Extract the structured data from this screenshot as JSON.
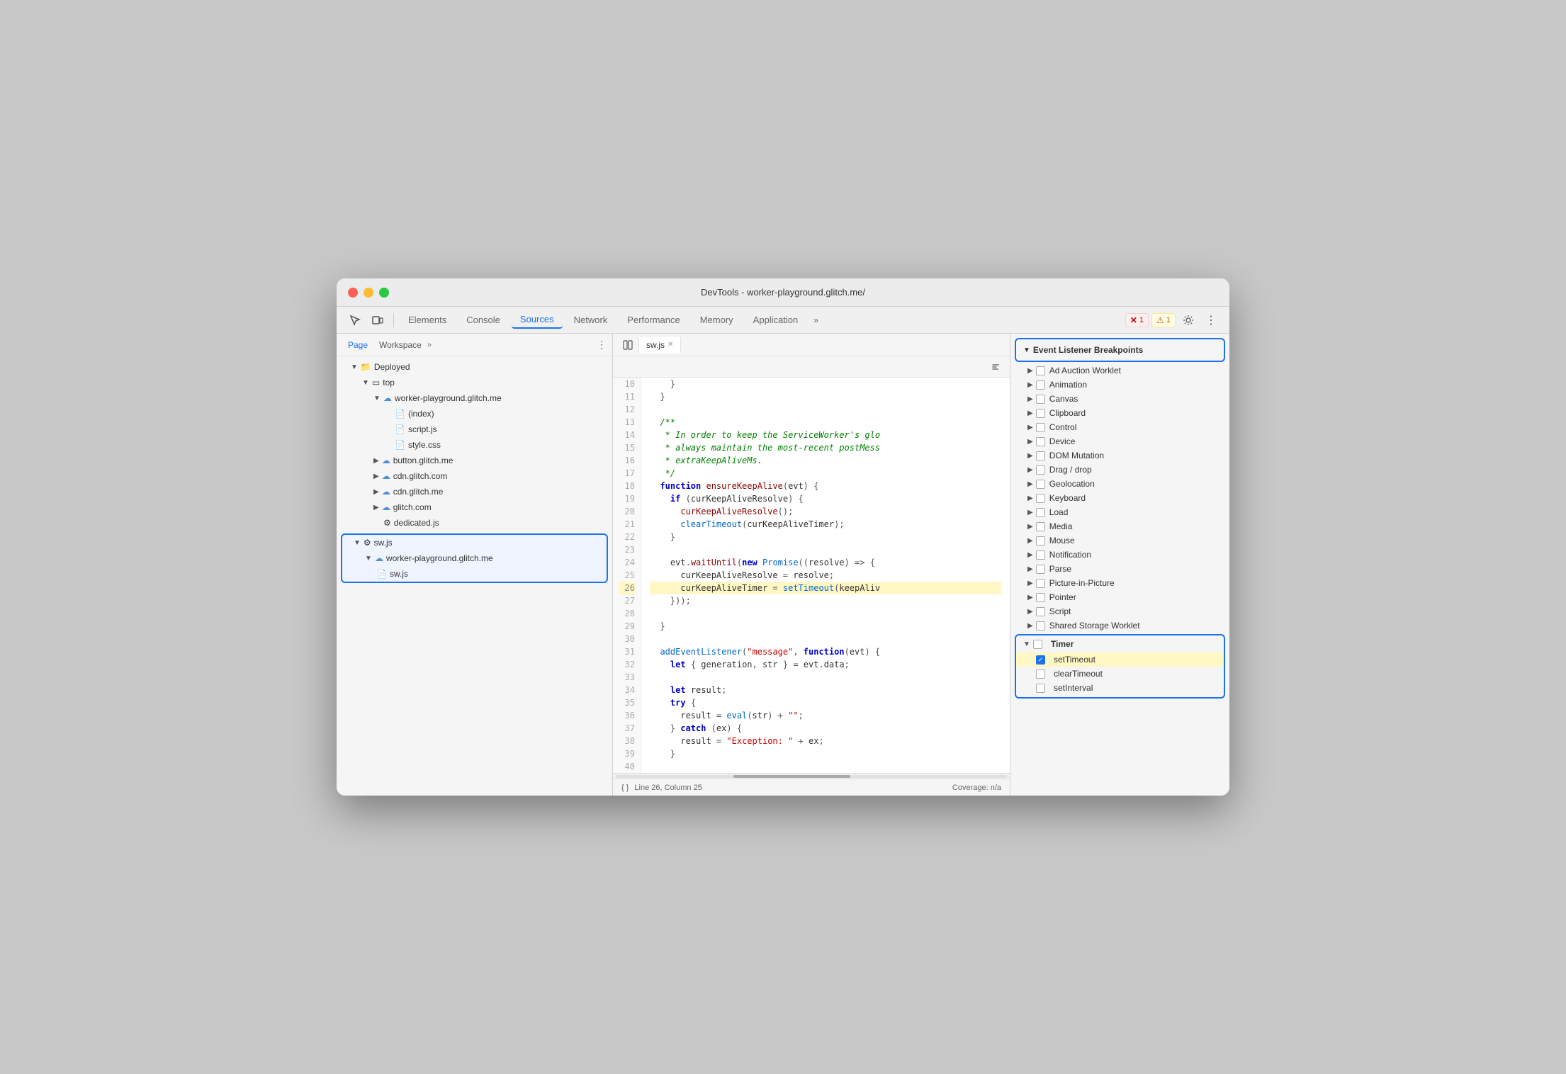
{
  "window": {
    "title": "DevTools - worker-playground.glitch.me/"
  },
  "toolbar": {
    "tabs": [
      "Elements",
      "Console",
      "Sources",
      "Network",
      "Performance",
      "Memory",
      "Application"
    ],
    "active_tab": "Sources",
    "error_count": "1",
    "warning_count": "1"
  },
  "subtoolbar": {
    "tabs": [
      "Page",
      "Workspace"
    ],
    "active_tab": "Page"
  },
  "file_tree": {
    "items": [
      {
        "label": "Deployed",
        "indent": 1,
        "type": "folder",
        "expanded": true
      },
      {
        "label": "top",
        "indent": 2,
        "type": "folder",
        "expanded": true
      },
      {
        "label": "worker-playground.glitch.me",
        "indent": 3,
        "type": "cloud-folder",
        "expanded": true
      },
      {
        "label": "(index)",
        "indent": 4,
        "type": "file"
      },
      {
        "label": "script.js",
        "indent": 4,
        "type": "js-file"
      },
      {
        "label": "style.css",
        "indent": 4,
        "type": "css-file"
      },
      {
        "label": "button.glitch.me",
        "indent": 3,
        "type": "cloud-folder",
        "expanded": false
      },
      {
        "label": "cdn.glitch.com",
        "indent": 3,
        "type": "cloud-folder",
        "expanded": false
      },
      {
        "label": "cdn.glitch.me",
        "indent": 3,
        "type": "cloud-folder",
        "expanded": false
      },
      {
        "label": "glitch.com",
        "indent": 3,
        "type": "cloud-folder",
        "expanded": false
      },
      {
        "label": "dedicated.js",
        "indent": 3,
        "type": "gear-file"
      },
      {
        "label": "sw.js",
        "indent": 2,
        "type": "gear-folder",
        "expanded": true,
        "selected": true
      },
      {
        "label": "worker-playground.glitch.me",
        "indent": 3,
        "type": "cloud-folder",
        "selected": true
      },
      {
        "label": "sw.js",
        "indent": 4,
        "type": "js-file",
        "selected": true
      }
    ]
  },
  "editor": {
    "tab_name": "sw.js",
    "lines": [
      {
        "num": 10,
        "code": "    }"
      },
      {
        "num": 11,
        "code": "  }"
      },
      {
        "num": 12,
        "code": ""
      },
      {
        "num": 13,
        "code": "  /**"
      },
      {
        "num": 14,
        "code": "   * In order to keep the ServiceWorker's glo"
      },
      {
        "num": 15,
        "code": "   * always maintain the most-recent postMess"
      },
      {
        "num": 16,
        "code": "   * extraKeepAliveMs."
      },
      {
        "num": 17,
        "code": "   */"
      },
      {
        "num": 18,
        "code": "  function ensureKeepAlive(evt) {"
      },
      {
        "num": 19,
        "code": "    if (curKeepAliveResolve) {"
      },
      {
        "num": 20,
        "code": "      curKeepAliveResolve();"
      },
      {
        "num": 21,
        "code": "      clearTimeout(curKeepAliveTimer);"
      },
      {
        "num": 22,
        "code": "    }"
      },
      {
        "num": 23,
        "code": ""
      },
      {
        "num": 24,
        "code": "    evt.waitUntil(new Promise((resolve) => {"
      },
      {
        "num": 25,
        "code": "      curKeepAliveResolve = resolve;"
      },
      {
        "num": 26,
        "code": "      curKeepAliveTimer = setTimeout(keepAliv",
        "highlighted": true
      },
      {
        "num": 27,
        "code": "    }));"
      },
      {
        "num": 28,
        "code": ""
      },
      {
        "num": 29,
        "code": "  }"
      },
      {
        "num": 30,
        "code": ""
      },
      {
        "num": 31,
        "code": "  addEventListener(\"message\", function(evt) {"
      },
      {
        "num": 32,
        "code": "    let { generation, str } = evt.data;"
      },
      {
        "num": 33,
        "code": ""
      },
      {
        "num": 34,
        "code": "    let result;"
      },
      {
        "num": 35,
        "code": "    try {"
      },
      {
        "num": 36,
        "code": "      result = eval(str) + \"\";"
      },
      {
        "num": 37,
        "code": "    } catch (ex) {"
      },
      {
        "num": 38,
        "code": "      result = \"Exception: \" + ex;"
      },
      {
        "num": 39,
        "code": "    }"
      },
      {
        "num": 40,
        "code": ""
      }
    ],
    "status_line": "Line 26, Column 25",
    "coverage": "Coverage: n/a"
  },
  "breakpoints": {
    "header": "Event Listener Breakpoints",
    "items": [
      {
        "label": "Ad Auction Worklet",
        "expanded": false,
        "checked": false
      },
      {
        "label": "Animation",
        "expanded": false,
        "checked": false
      },
      {
        "label": "Canvas",
        "expanded": false,
        "checked": false
      },
      {
        "label": "Clipboard",
        "expanded": false,
        "checked": false
      },
      {
        "label": "Control",
        "expanded": false,
        "checked": false
      },
      {
        "label": "Device",
        "expanded": false,
        "checked": false
      },
      {
        "label": "DOM Mutation",
        "expanded": false,
        "checked": false
      },
      {
        "label": "Drag / drop",
        "expanded": false,
        "checked": false
      },
      {
        "label": "Geolocation",
        "expanded": false,
        "checked": false
      },
      {
        "label": "Keyboard",
        "expanded": false,
        "checked": false
      },
      {
        "label": "Load",
        "expanded": false,
        "checked": false
      },
      {
        "label": "Media",
        "expanded": false,
        "checked": false
      },
      {
        "label": "Mouse",
        "expanded": false,
        "checked": false
      },
      {
        "label": "Notification",
        "expanded": false,
        "checked": false
      },
      {
        "label": "Parse",
        "expanded": false,
        "checked": false
      },
      {
        "label": "Picture-in-Picture",
        "expanded": false,
        "checked": false
      },
      {
        "label": "Pointer",
        "expanded": false,
        "checked": false
      },
      {
        "label": "Script",
        "expanded": false,
        "checked": false
      },
      {
        "label": "Shared Storage Worklet",
        "expanded": false,
        "checked": false
      }
    ],
    "timer": {
      "label": "Timer",
      "expanded": true,
      "children": [
        {
          "label": "setTimeout",
          "checked": true,
          "highlighted": true
        },
        {
          "label": "clearTimeout",
          "checked": false
        },
        {
          "label": "setInterval",
          "checked": false
        }
      ]
    }
  }
}
